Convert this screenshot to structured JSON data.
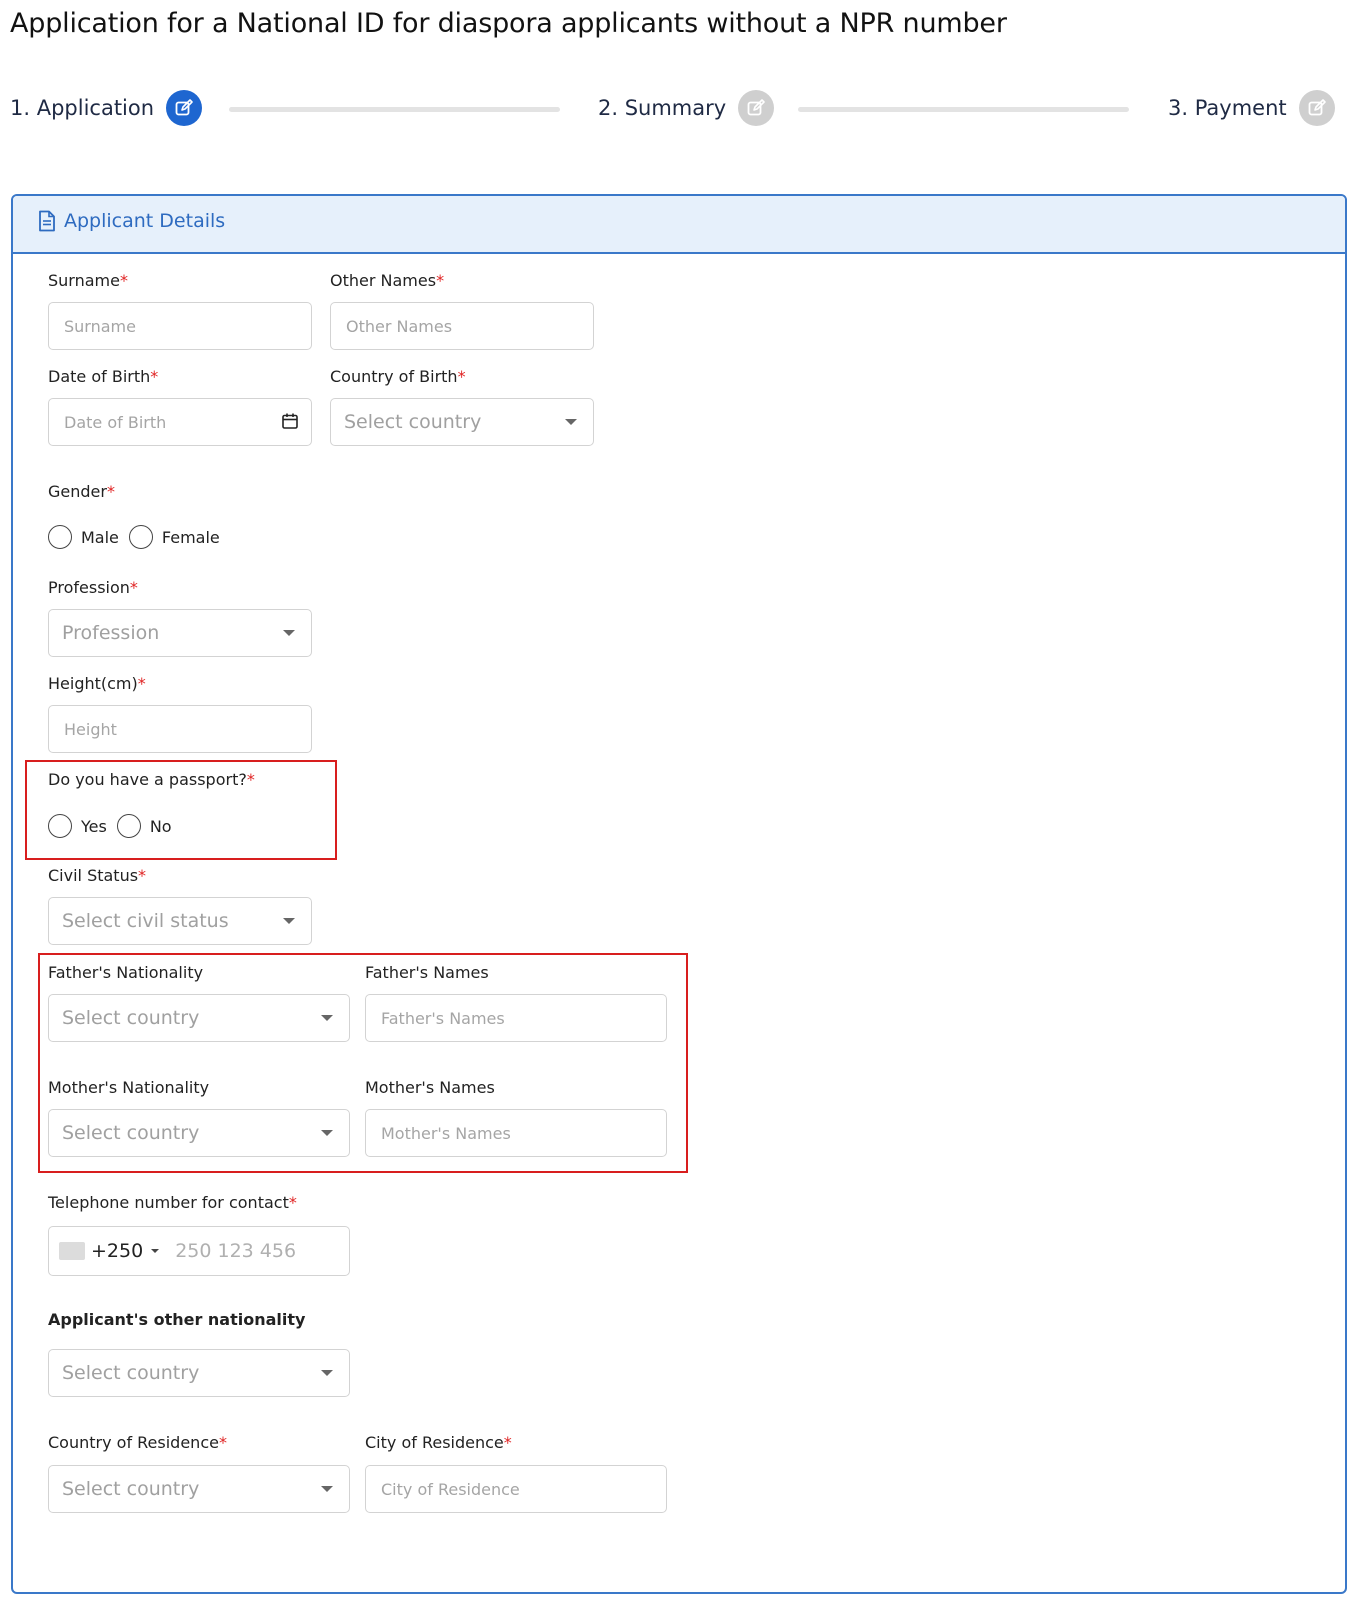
{
  "page": {
    "title": "Application for a National ID for diaspora applicants without a NPR number"
  },
  "stepper": {
    "steps": [
      {
        "label": "1. Application",
        "icon": "edit-icon",
        "state": "active"
      },
      {
        "label": "2. Summary",
        "icon": "edit-icon",
        "state": "inactive"
      },
      {
        "label": "3. Payment",
        "icon": "edit-icon",
        "state": "inactive"
      }
    ]
  },
  "card": {
    "title": "Applicant Details",
    "icon": "document-icon"
  },
  "form": {
    "required_marker": "*",
    "surname": {
      "label": "Surname",
      "placeholder": "Surname"
    },
    "other_names": {
      "label": "Other Names",
      "placeholder": "Other Names"
    },
    "dob": {
      "label": "Date of Birth",
      "placeholder": "Date of Birth"
    },
    "country_of_birth": {
      "label": "Country of Birth",
      "placeholder": "Select country"
    },
    "gender": {
      "label": "Gender",
      "options": [
        "Male",
        "Female"
      ]
    },
    "profession": {
      "label": "Profession",
      "placeholder": "Profession"
    },
    "height": {
      "label": "Height(cm)",
      "placeholder": "Height"
    },
    "passport": {
      "label": "Do you have a passport?",
      "options": [
        "Yes",
        "No"
      ]
    },
    "civil_status": {
      "label": "Civil Status",
      "placeholder": "Select civil status"
    },
    "father_nationality": {
      "label": "Father's Nationality",
      "placeholder": "Select country"
    },
    "father_names": {
      "label": "Father's Names",
      "placeholder": "Father's Names"
    },
    "mother_nationality": {
      "label": "Mother's Nationality",
      "placeholder": "Select country"
    },
    "mother_names": {
      "label": "Mother's Names",
      "placeholder": "Mother's Names"
    },
    "telephone": {
      "label": "Telephone number for contact",
      "dial_code": "+250",
      "placeholder": "250 123 456"
    },
    "other_nationality": {
      "label": "Applicant's other nationality",
      "placeholder": "Select country"
    },
    "country_of_residence": {
      "label": "Country of Residence",
      "placeholder": "Select country"
    },
    "city_of_residence": {
      "label": "City of Residence",
      "placeholder": "City of Residence"
    }
  },
  "colors": {
    "accent": "#1e66d0",
    "card_border": "#3a78c9",
    "card_header_bg": "#e6f0fb",
    "required": "#e02424",
    "highlight_box": "#d81e1e",
    "inactive_step": "#cfcfcf"
  }
}
